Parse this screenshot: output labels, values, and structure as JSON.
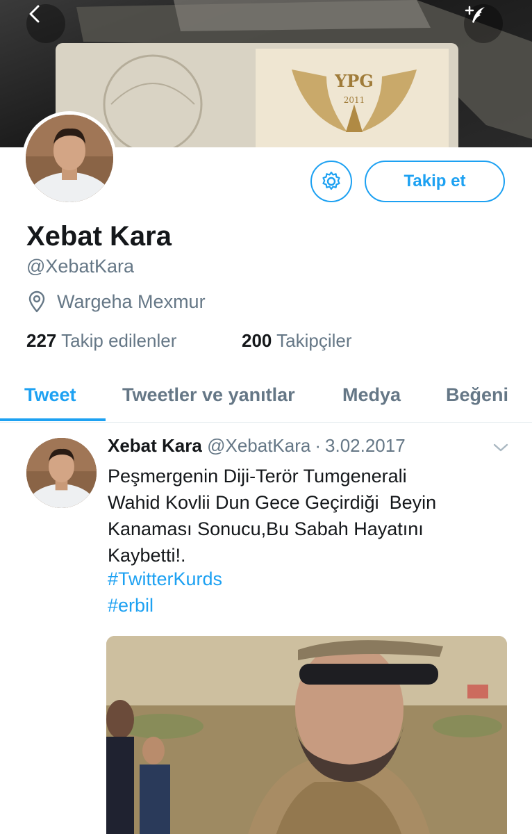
{
  "header": {
    "back_icon": "chevron-left-icon",
    "compose_icon": "compose-feather-icon",
    "banner_text": "YPG",
    "banner_year": "2011"
  },
  "profile": {
    "display_name": "Xebat Kara",
    "handle": "@XebatKara",
    "location": "Wargeha Mexmur",
    "location_icon": "location-pin-icon",
    "following_count": "227",
    "following_label": "Takip edilenler",
    "followers_count": "200",
    "followers_label": "Takipçiler",
    "follow_button_label": "Takip et",
    "settings_icon": "gear-icon"
  },
  "tabs": [
    {
      "label": "Tweet",
      "active": true
    },
    {
      "label": "Tweetler ve yanıtlar",
      "active": false
    },
    {
      "label": "Medya",
      "active": false
    },
    {
      "label": "Beğeni",
      "active": false
    }
  ],
  "tweet": {
    "author_name": "Xebat Kara",
    "author_handle": "@XebatKara",
    "separator": "·",
    "date": "3.02.2017",
    "lines": [
      "Peşmergenin Diji-Terör Tumgenerali",
      "Wahid Kovlii Dun Gece Geçirdiği  Beyin",
      "Kanaması Sonucu,Bu Sabah Hayatını",
      "Kaybetti!."
    ],
    "hashtags": [
      "#TwitterKurds",
      "#erbil"
    ],
    "menu_icon": "chevron-down-icon"
  },
  "colors": {
    "accent": "#1da1f2",
    "text_primary": "#14171a",
    "text_secondary": "#657786",
    "divider": "#e1e8ed"
  }
}
